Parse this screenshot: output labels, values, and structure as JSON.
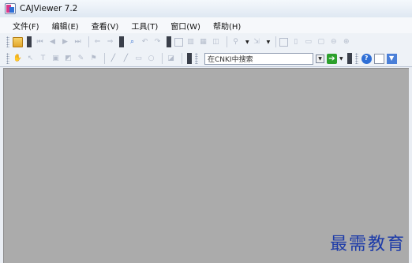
{
  "window": {
    "title": "CAJViewer 7.2",
    "app_icon": "cajviewer-icon"
  },
  "menu": [
    {
      "label": "文件(F)"
    },
    {
      "label": "编辑(E)"
    },
    {
      "label": "查看(V)"
    },
    {
      "label": "工具(T)"
    },
    {
      "label": "窗口(W)"
    },
    {
      "label": "帮助(H)"
    }
  ],
  "toolbar": {
    "search_placeholder": "在CNKI中搜索",
    "go_glyph": "➔",
    "dropdown_glyph": "▼"
  },
  "watermark": "最需教育",
  "colors": {
    "workspace": "#ababab",
    "titlebar": "#dfe8f2",
    "toolbar": "#eef2f7",
    "accent": "#2f6fd6",
    "watermark": "#1d3ba8"
  }
}
